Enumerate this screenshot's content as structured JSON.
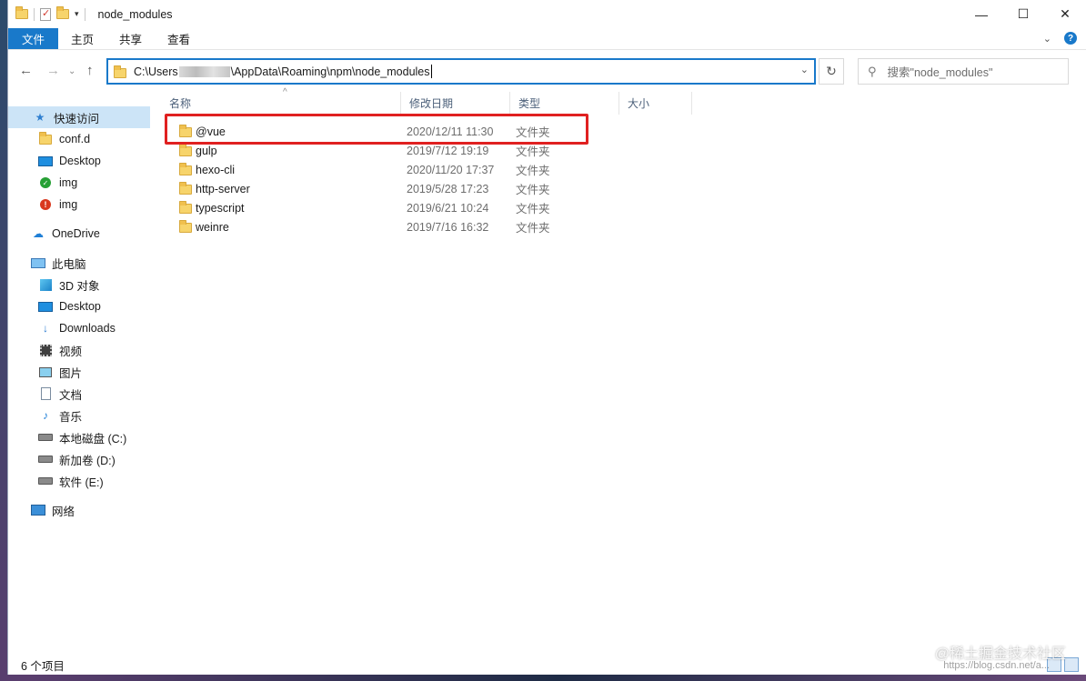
{
  "window": {
    "title": "node_modules"
  },
  "ribbon": {
    "tabs": [
      "文件",
      "主页",
      "共享",
      "查看"
    ]
  },
  "address": {
    "part1": "C:\\Users",
    "part2": "\\AppData\\Roaming\\npm\\node_modules"
  },
  "search": {
    "placeholder": "搜索\"node_modules\""
  },
  "sidebar": {
    "quick_access": "快速访问",
    "quick_items": [
      "conf.d",
      "Desktop",
      "img",
      "img"
    ],
    "onedrive": "OneDrive",
    "this_pc": "此电脑",
    "pc_items": [
      "3D 对象",
      "Desktop",
      "Downloads",
      "视频",
      "图片",
      "文档",
      "音乐",
      "本地磁盘 (C:)",
      "新加卷 (D:)",
      "软件 (E:)"
    ],
    "network": "网络"
  },
  "columns": {
    "name": "名称",
    "date": "修改日期",
    "type": "类型",
    "size": "大小"
  },
  "files": [
    {
      "name": "@vue",
      "date": "2020/12/11 11:30",
      "type": "文件夹"
    },
    {
      "name": "gulp",
      "date": "2019/7/12 19:19",
      "type": "文件夹"
    },
    {
      "name": "hexo-cli",
      "date": "2020/11/20 17:37",
      "type": "文件夹"
    },
    {
      "name": "http-server",
      "date": "2019/5/28 17:23",
      "type": "文件夹"
    },
    {
      "name": "typescript",
      "date": "2019/6/21 10:24",
      "type": "文件夹"
    },
    {
      "name": "weinre",
      "date": "2019/7/16 16:32",
      "type": "文件夹"
    }
  ],
  "status": {
    "count": "6 个项目"
  },
  "watermark": {
    "main": "@稀土掘金技术社区",
    "sub": "https://blog.csdn.net/a..."
  },
  "colors": {
    "accent": "#1979ca",
    "highlight": "#e02020",
    "selection": "#cce4f7"
  },
  "icons": [
    "folder-icon",
    "check-doc-icon",
    "chevron-down-icon",
    "minimize-icon",
    "maximize-icon",
    "close-icon",
    "help-icon",
    "back-arrow-icon",
    "forward-arrow-icon",
    "up-arrow-icon",
    "refresh-icon",
    "search-icon",
    "star-icon",
    "onedrive-icon",
    "pc-icon",
    "network-icon"
  ]
}
